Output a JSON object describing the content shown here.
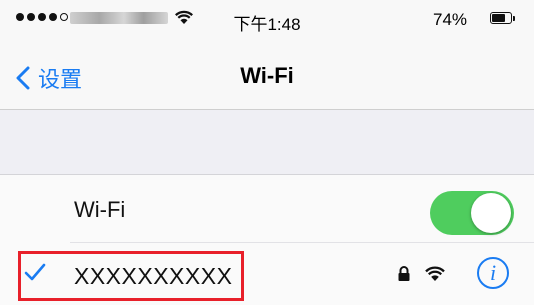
{
  "status_bar": {
    "time": "下午1:48",
    "battery_percent": "74%",
    "battery_level": 0.74,
    "signal_bars_filled": 4,
    "signal_bars_total": 5
  },
  "nav": {
    "back_label": "设置",
    "title": "Wi-Fi"
  },
  "wifi_row": {
    "label": "Wi-Fi",
    "enabled": true
  },
  "network_row": {
    "name": "XXXXXXXXXX",
    "connected": true,
    "secured": true,
    "icons": [
      "checkmark-icon",
      "lock-icon",
      "wifi-signal-icon",
      "info-icon"
    ]
  },
  "info_glyph": "i",
  "colors": {
    "accent": "#1a7cf2",
    "toggle_on": "#4fcd5e",
    "highlight": "#e8202a"
  }
}
